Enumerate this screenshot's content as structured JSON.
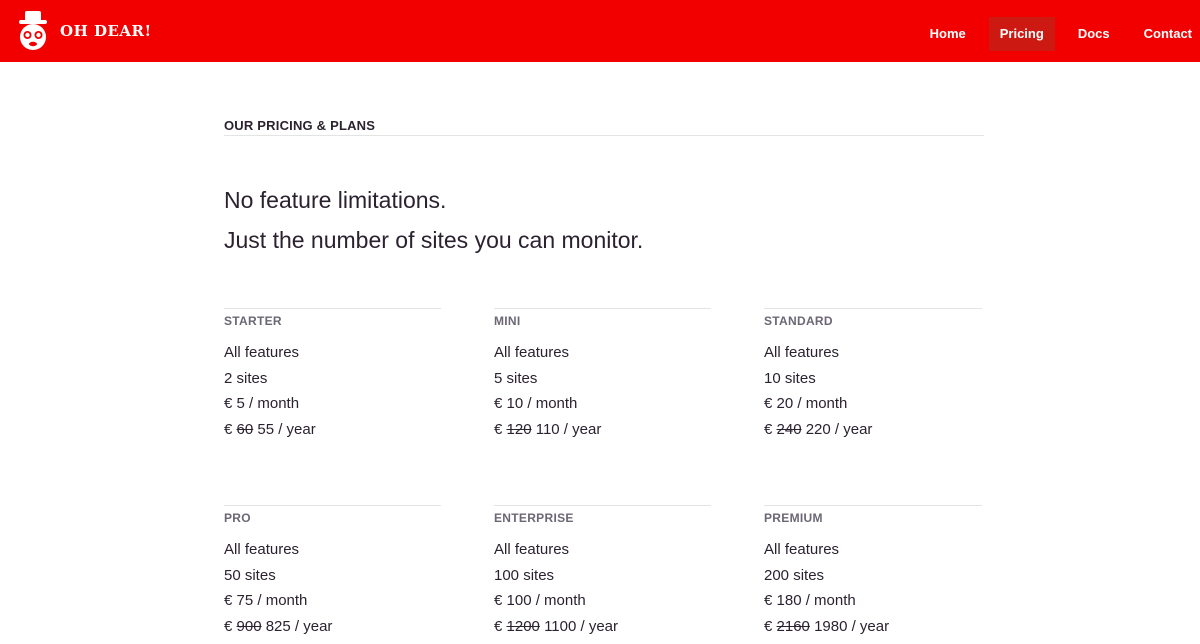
{
  "brand": {
    "name": "OH DEAR!"
  },
  "nav": [
    {
      "label": "Home",
      "active": false
    },
    {
      "label": "Pricing",
      "active": true
    },
    {
      "label": "Docs",
      "active": false
    },
    {
      "label": "Contact",
      "active": false
    }
  ],
  "colors": {
    "header": "#f20000",
    "active_nav": "#cc1a12",
    "text": "#2b2230",
    "muted": "#6c6774"
  },
  "main": {
    "section_title": "OUR PRICING & PLANS",
    "lead_line1": "No feature limitations.",
    "lead_line2": "Just the number of sites you can monitor."
  },
  "plans": [
    {
      "name": "STARTER",
      "features": "All features",
      "sites": "2 sites",
      "monthly": "€ 5 / month",
      "yearly_prefix": "€",
      "yearly_old": "60",
      "yearly_new": "55 / year"
    },
    {
      "name": "MINI",
      "features": "All features",
      "sites": "5 sites",
      "monthly": "€ 10 / month",
      "yearly_prefix": "€",
      "yearly_old": "120",
      "yearly_new": "110 / year"
    },
    {
      "name": "STANDARD",
      "features": "All features",
      "sites": "10 sites",
      "monthly": "€ 20 / month",
      "yearly_prefix": "€",
      "yearly_old": "240",
      "yearly_new": "220 / year"
    },
    {
      "name": "PRO",
      "features": "All features",
      "sites": "50 sites",
      "monthly": "€ 75 / month",
      "yearly_prefix": "€",
      "yearly_old": "900",
      "yearly_new": "825 / year"
    },
    {
      "name": "ENTERPRISE",
      "features": "All features",
      "sites": "100 sites",
      "monthly": "€ 100 / month",
      "yearly_prefix": "€",
      "yearly_old": "1200",
      "yearly_new": "1100 / year"
    },
    {
      "name": "PREMIUM",
      "features": "All features",
      "sites": "200 sites",
      "monthly": "€ 180 / month",
      "yearly_prefix": "€",
      "yearly_old": "2160",
      "yearly_new": "1980 / year"
    }
  ]
}
